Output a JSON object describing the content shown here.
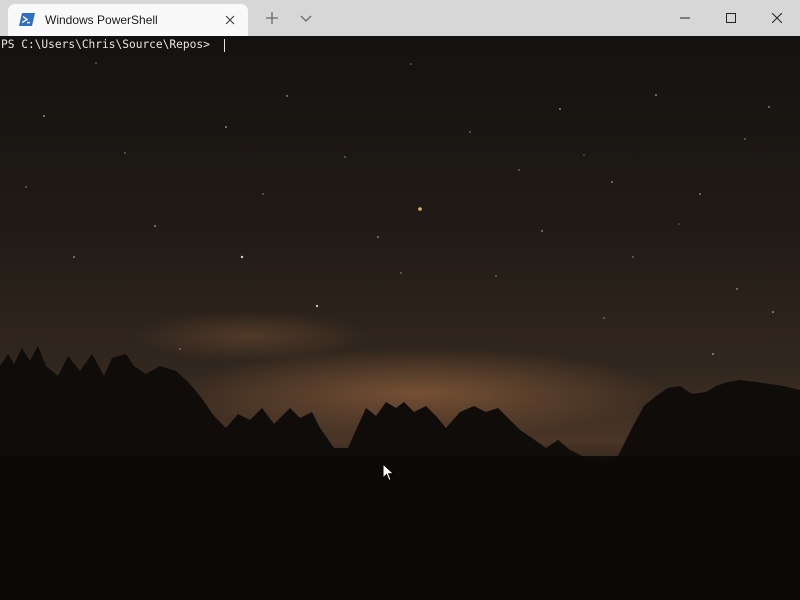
{
  "window": {
    "tab_title": "Windows PowerShell",
    "tab_icon": "powershell-icon",
    "controls": {
      "new_tab_icon": "plus-icon",
      "dropdown_icon": "chevron-down-icon",
      "minimize_icon": "minimize-icon",
      "maximize_icon": "maximize-icon",
      "close_icon": "close-icon"
    }
  },
  "terminal": {
    "prompt": "PS C:\\Users\\Chris\\Source\\Repos> ",
    "background": "night-sky-with-tree-silhouettes",
    "colors": {
      "titlebar": "#d7d7d7",
      "tab": "#f9f9f9",
      "text": "#e6e6e6",
      "accent": "#2f6fc4"
    }
  }
}
